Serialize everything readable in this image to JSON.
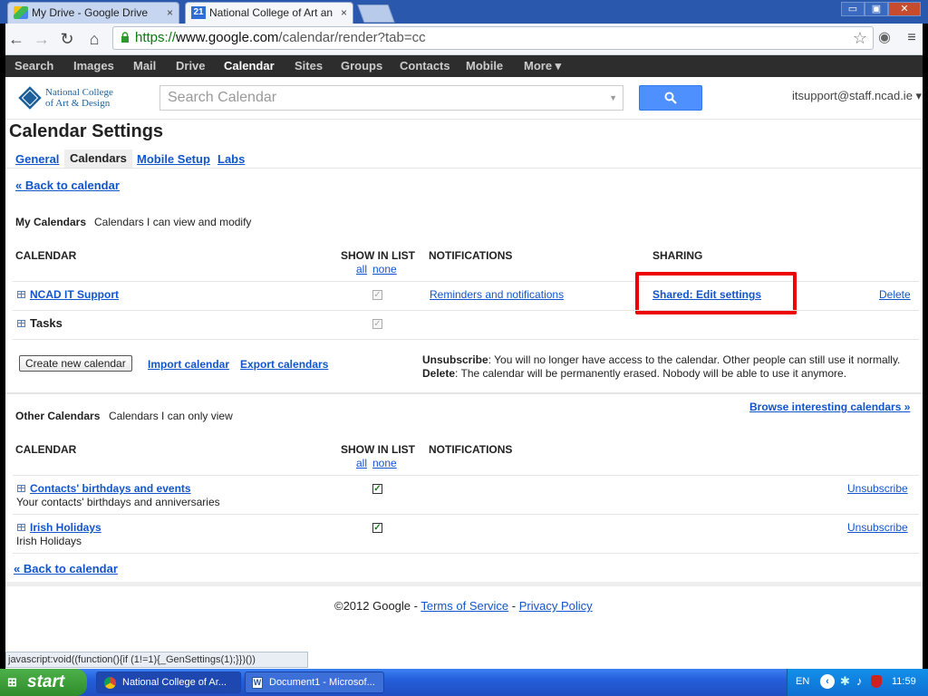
{
  "browser": {
    "tabs": [
      {
        "title": "My Drive - Google Drive",
        "close": "×"
      },
      {
        "title": "National College of Art and D",
        "icon_text": "21",
        "close": "×"
      }
    ],
    "window_buttons": [
      "▭",
      "▣",
      "✕"
    ],
    "nav_icons": [
      "back-icon",
      "forward-icon",
      "reload-icon",
      "home-icon"
    ],
    "url": {
      "scheme": "https://",
      "host": "www.google.com",
      "path": "/calendar/render?tab=cc"
    }
  },
  "gbar": {
    "items": [
      "Search",
      "Images",
      "Mail",
      "Drive",
      "Calendar",
      "Sites",
      "Groups",
      "Contacts",
      "Mobile",
      "More ▾"
    ],
    "active": "Calendar"
  },
  "header": {
    "logo_line1": "National College",
    "logo_line2": "of Art & Design",
    "search_placeholder": "Search Calendar",
    "account": "itsupport@staff.ncad.ie ▾"
  },
  "settings": {
    "title": "Calendar Settings",
    "tabs": [
      "General",
      "Calendars",
      "Mobile Setup",
      "Labs"
    ],
    "active_tab": "Calendars",
    "back_link": "« Back to calendar",
    "my_calendars": {
      "title": "My Calendars",
      "subtitle": "Calendars I can view and modify",
      "columns": {
        "calendar": "CALENDAR",
        "show_in_list": "SHOW IN LIST",
        "all": "all",
        "none": "none",
        "notifications": "NOTIFICATIONS",
        "sharing": "SHARING"
      },
      "rows": [
        {
          "name": "NCAD IT Support",
          "checked": true,
          "notifications": "Reminders and notifications",
          "sharing": "Shared: Edit settings",
          "action": "Delete"
        },
        {
          "name": "Tasks",
          "checked": true
        }
      ],
      "create_button": "Create new calendar",
      "import_link": "Import calendar",
      "export_link": "Export calendars",
      "unsubscribe_label": "Unsubscribe",
      "unsubscribe_text": ": You will no longer have access to the calendar. Other people can still use it normally.",
      "delete_label": "Delete",
      "delete_text": ": The calendar will be permanently erased. Nobody will be able to use it anymore."
    },
    "other_calendars": {
      "title": "Other Calendars",
      "subtitle": "Calendars I can only view",
      "browse_link": "Browse interesting calendars »",
      "columns": {
        "calendar": "CALENDAR",
        "show_in_list": "SHOW IN LIST",
        "all": "all",
        "none": "none",
        "notifications": "NOTIFICATIONS"
      },
      "rows": [
        {
          "name": "Contacts' birthdays and events",
          "desc": "Your contacts' birthdays and anniversaries",
          "checked": true,
          "action": "Unsubscribe"
        },
        {
          "name": "Irish Holidays",
          "desc": "Irish Holidays",
          "checked": true,
          "action": "Unsubscribe"
        }
      ]
    },
    "back_link_bottom": "« Back to calendar"
  },
  "footer": {
    "copyright": "©2012 Google - ",
    "terms": "Terms of Service",
    "sep": " - ",
    "privacy": "Privacy Policy"
  },
  "statusbar": "javascript:void((function(){if (1!=1){_GenSettings(1);}})())",
  "taskbar": {
    "start": "start",
    "tasks": [
      "National College of Ar...",
      "Document1 - Microsof..."
    ],
    "lang": "EN",
    "time": "11:59"
  },
  "colors": {
    "link": "#1155cc",
    "highlight": "#ee0000",
    "gbar": "#2d2d2d",
    "search_button": "#4d90fe"
  }
}
